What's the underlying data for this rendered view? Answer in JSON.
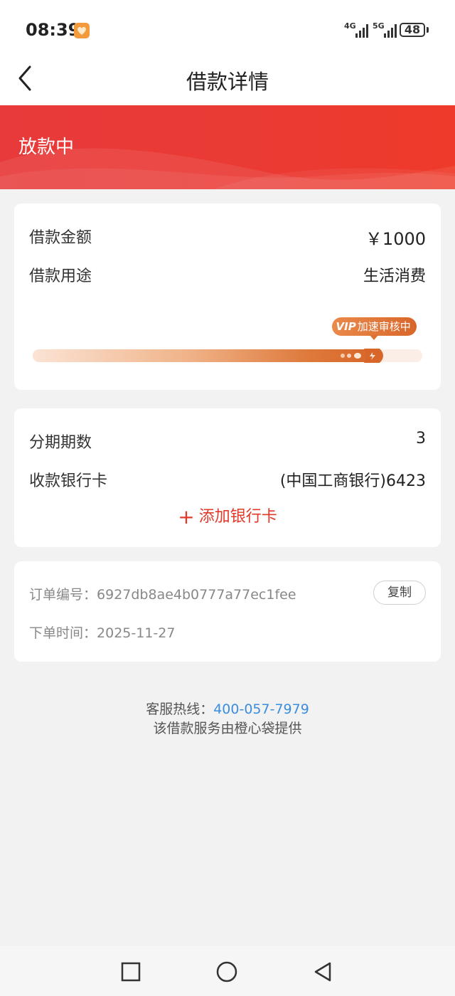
{
  "status_bar": {
    "time": "08:39",
    "network_1": "4G",
    "network_2": "5G",
    "battery": "48"
  },
  "nav": {
    "title": "借款详情",
    "back_icon": "chevron-left-icon"
  },
  "banner": {
    "status": "放款中",
    "color": "#e83a3a"
  },
  "loan_card": {
    "amount_label": "借款金额",
    "amount_value": "￥1000",
    "purpose_label": "借款用途",
    "purpose_value": "生活消费",
    "progress": {
      "fraction": 0.93,
      "badge_vip": "VIP",
      "badge_text": "加速审核中"
    }
  },
  "repay_card": {
    "installments_label": "分期期数",
    "installments_value": "3",
    "bank_label": "收款银行卡",
    "bank_value": "(中国工商银行)6423",
    "add_bank_plus": "+",
    "add_bank_text": "添加银行卡"
  },
  "order_card": {
    "order_no_label": "订单编号：",
    "order_no_value": "6927db8ae4b0777a77ec1fee",
    "copy_button": "复制",
    "order_time_label": "下单时间：",
    "order_time_value": "2025-11-27"
  },
  "footer": {
    "hotline_label": "客服热线：",
    "hotline_number": "400-057-7979",
    "provider_text": "该借款服务由橙心袋提供"
  },
  "system_nav": {
    "recent_icon": "square-icon",
    "home_icon": "circle-icon",
    "back_icon": "triangle-back-icon"
  },
  "colors": {
    "accent_red": "#e23a2a",
    "link_blue": "#3b8de0",
    "progress_orange": "#d8662a"
  }
}
